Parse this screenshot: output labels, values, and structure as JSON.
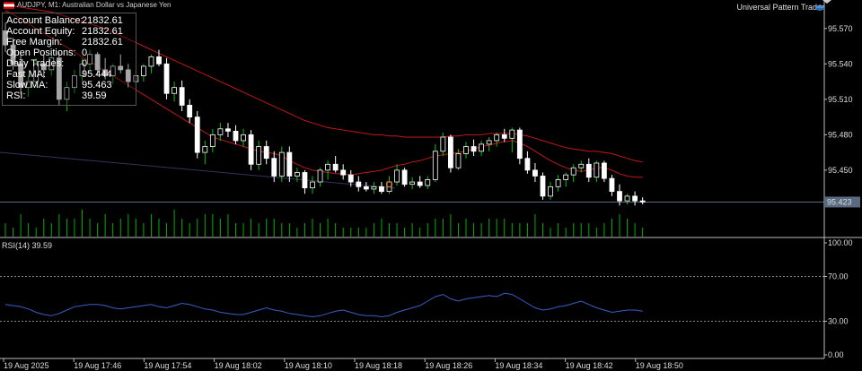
{
  "window": {
    "title": "AUDJPY, M1: Australian Dollar vs Japanese Yen",
    "expert_name": "Universal Pattern Trader"
  },
  "info_panel": {
    "rows": [
      {
        "label": "Account Balance:",
        "value": "21832.61"
      },
      {
        "label": "Account Equity:",
        "value": "21832.61"
      },
      {
        "label": "Free Margin:",
        "value": "21832.61"
      },
      {
        "label": "Open Positions:",
        "value": "0"
      },
      {
        "label": "Daily Trades:",
        "value": "0"
      },
      {
        "label": "Fast MA:",
        "value": "95.444"
      },
      {
        "label": "Slow MA:",
        "value": "95.463"
      },
      {
        "label": "RSI:",
        "value": "39.59"
      }
    ]
  },
  "price_axis": {
    "ticks": [
      "95.570",
      "95.540",
      "95.510",
      "95.480",
      "95.450"
    ],
    "current_price": "95.423"
  },
  "rsi_indicator": {
    "label": "RSI(14) 39.59",
    "ticks": [
      "100.00",
      "70.00",
      "30.00",
      "0.00"
    ]
  },
  "time_axis": {
    "ticks": [
      "19 Aug 2025",
      "19 Aug 17:46",
      "19 Aug 17:54",
      "19 Aug 18:02",
      "19 Aug 18:10",
      "19 Aug 18:18",
      "19 Aug 18:26",
      "19 Aug 18:34",
      "19 Aug 18:42",
      "19 Aug 18:50"
    ]
  },
  "colors": {
    "background": "#000000",
    "candle": "#ffffff",
    "bull_wick": "#00c800",
    "ma": "#c01818",
    "rsi": "#3a5ec8",
    "grid": "#888888",
    "volume": "#00b000",
    "current_price_bg": "#5a6a80"
  },
  "chart_data": {
    "type": "candlestick",
    "symbol": "AUDJPY",
    "timeframe": "M1",
    "ylim": [
      95.415,
      95.585
    ],
    "candles": [
      [
        95.568,
        95.575,
        95.55,
        95.556
      ],
      [
        95.556,
        95.562,
        95.535,
        95.54
      ],
      [
        95.54,
        95.548,
        95.515,
        95.52
      ],
      [
        95.52,
        95.53,
        95.512,
        95.525
      ],
      [
        95.525,
        95.545,
        95.52,
        95.54
      ],
      [
        95.54,
        95.548,
        95.528,
        95.535
      ],
      [
        95.535,
        95.55,
        95.53,
        95.545
      ],
      [
        95.545,
        95.55,
        95.505,
        95.51
      ],
      [
        95.51,
        95.525,
        95.5,
        95.52
      ],
      [
        95.52,
        95.535,
        95.515,
        95.53
      ],
      [
        95.53,
        95.545,
        95.525,
        95.54
      ],
      [
        95.54,
        95.552,
        95.534,
        95.548
      ],
      [
        95.548,
        95.55,
        95.53,
        95.535
      ],
      [
        95.535,
        95.545,
        95.527,
        95.53
      ],
      [
        95.53,
        95.54,
        95.523,
        95.538
      ],
      [
        95.538,
        95.548,
        95.532,
        95.535
      ],
      [
        95.535,
        95.54,
        95.52,
        95.525
      ],
      [
        95.525,
        95.535,
        95.518,
        95.53
      ],
      [
        95.53,
        95.54,
        95.525,
        95.538
      ],
      [
        95.538,
        95.548,
        95.532,
        95.546
      ],
      [
        95.546,
        95.552,
        95.538,
        95.54
      ],
      [
        95.54,
        95.545,
        95.51,
        95.515
      ],
      [
        95.515,
        95.525,
        95.508,
        95.52
      ],
      [
        95.52,
        95.526,
        95.5,
        95.505
      ],
      [
        95.505,
        95.51,
        95.49,
        95.495
      ],
      [
        95.495,
        95.5,
        95.46,
        95.465
      ],
      [
        95.465,
        95.475,
        95.455,
        95.47
      ],
      [
        95.47,
        95.485,
        95.465,
        95.48
      ],
      [
        95.48,
        95.49,
        95.475,
        95.485
      ],
      [
        95.485,
        95.49,
        95.478,
        95.483
      ],
      [
        95.483,
        95.488,
        95.472,
        95.475
      ],
      [
        95.475,
        95.485,
        95.47,
        95.48
      ],
      [
        95.48,
        95.484,
        95.45,
        95.455
      ],
      [
        95.455,
        95.475,
        95.45,
        95.47
      ],
      [
        95.47,
        95.475,
        95.455,
        95.46
      ],
      [
        95.46,
        95.466,
        95.44,
        95.445
      ],
      [
        95.445,
        95.47,
        95.44,
        95.465
      ],
      [
        95.465,
        95.47,
        95.44,
        95.445
      ],
      [
        95.445,
        95.452,
        95.44,
        95.448
      ],
      [
        95.448,
        95.45,
        95.43,
        95.435
      ],
      [
        95.435,
        95.445,
        95.43,
        95.44
      ],
      [
        95.44,
        95.452,
        95.436,
        95.45
      ],
      [
        95.45,
        95.458,
        95.442,
        95.455
      ],
      [
        95.455,
        95.462,
        95.448,
        95.45
      ],
      [
        95.45,
        95.455,
        95.442,
        95.446
      ],
      [
        95.446,
        95.45,
        95.436,
        95.44
      ],
      [
        95.44,
        95.445,
        95.432,
        95.436
      ],
      [
        95.436,
        95.44,
        95.432,
        95.434
      ],
      [
        95.434,
        95.44,
        95.43,
        95.436
      ],
      [
        95.436,
        95.44,
        95.43,
        95.432
      ],
      [
        95.432,
        95.445,
        95.43,
        95.44
      ],
      [
        95.44,
        95.455,
        95.437,
        95.45
      ],
      [
        95.45,
        95.452,
        95.436,
        95.438
      ],
      [
        95.438,
        95.444,
        95.434,
        95.44
      ],
      [
        95.44,
        95.445,
        95.435,
        95.437
      ],
      [
        95.437,
        95.445,
        95.434,
        95.442
      ],
      [
        95.442,
        95.472,
        95.44,
        95.466
      ],
      [
        95.466,
        95.482,
        95.462,
        95.478
      ],
      [
        95.478,
        95.48,
        95.448,
        95.452
      ],
      [
        95.452,
        95.468,
        95.45,
        95.464
      ],
      [
        95.464,
        95.474,
        95.46,
        95.47
      ],
      [
        95.47,
        95.476,
        95.462,
        95.466
      ],
      [
        95.466,
        95.475,
        95.462,
        95.472
      ],
      [
        95.472,
        95.478,
        95.466,
        95.475
      ],
      [
        95.475,
        95.482,
        95.47,
        95.48
      ],
      [
        95.48,
        95.485,
        95.474,
        95.477
      ],
      [
        95.477,
        95.486,
        95.465,
        95.484
      ],
      [
        95.484,
        95.486,
        95.455,
        95.46
      ],
      [
        95.46,
        95.466,
        95.447,
        95.45
      ],
      [
        95.45,
        95.456,
        95.44,
        95.445
      ],
      [
        95.445,
        95.448,
        95.425,
        95.428
      ],
      [
        95.428,
        95.44,
        95.425,
        95.436
      ],
      [
        95.436,
        95.446,
        95.432,
        95.442
      ],
      [
        95.442,
        95.448,
        95.436,
        95.446
      ],
      [
        95.446,
        95.455,
        95.44,
        95.452
      ],
      [
        95.452,
        95.458,
        95.448,
        95.455
      ],
      [
        95.455,
        95.46,
        95.44,
        95.444
      ],
      [
        95.444,
        95.458,
        95.44,
        95.456
      ],
      [
        95.456,
        95.458,
        95.44,
        95.443
      ],
      [
        95.443,
        95.446,
        95.428,
        95.432
      ],
      [
        95.432,
        95.438,
        95.42,
        95.424
      ],
      [
        95.424,
        95.43,
        95.421,
        95.428
      ],
      [
        95.428,
        95.432,
        95.42,
        95.424
      ],
      [
        95.424,
        95.427,
        95.421,
        95.423
      ]
    ],
    "fast_ma": [
      95.585,
      95.582,
      95.578,
      95.574,
      95.57,
      95.566,
      95.562,
      95.558,
      95.554,
      95.55,
      95.546,
      95.542,
      95.538,
      95.534,
      95.53,
      95.526,
      95.522,
      95.518,
      95.514,
      95.51,
      95.506,
      95.502,
      95.498,
      95.494,
      95.49,
      95.486,
      95.482,
      95.478,
      95.476,
      95.474,
      95.472,
      95.47,
      95.468,
      95.466,
      95.465,
      95.464,
      95.462,
      95.458,
      95.455,
      95.452,
      95.45,
      95.449,
      95.448,
      95.447,
      95.447,
      95.446,
      95.447,
      95.448,
      95.449,
      95.45,
      95.452,
      95.454,
      95.455,
      95.457,
      95.458,
      95.46,
      95.462,
      95.463,
      95.464,
      95.465,
      95.466,
      95.468,
      95.47,
      95.471,
      95.473,
      95.474,
      95.475,
      95.473,
      95.47,
      95.466,
      95.462,
      95.458,
      95.455,
      95.452,
      95.45,
      95.449,
      95.45,
      95.452,
      95.452,
      95.45,
      95.447,
      95.445,
      95.444,
      95.444
    ],
    "slow_ma": [
      95.59,
      95.589,
      95.588,
      95.587,
      95.586,
      95.585,
      95.584,
      95.582,
      95.58,
      95.578,
      95.576,
      95.574,
      95.572,
      95.57,
      95.567,
      95.564,
      95.561,
      95.558,
      95.555,
      95.552,
      95.549,
      95.546,
      95.543,
      95.54,
      95.537,
      95.534,
      95.531,
      95.528,
      95.525,
      95.522,
      95.519,
      95.516,
      95.513,
      95.51,
      95.507,
      95.504,
      95.501,
      95.498,
      95.495,
      95.492,
      95.49,
      95.488,
      95.486,
      95.485,
      95.484,
      95.483,
      95.482,
      95.481,
      95.48,
      95.48,
      95.479,
      95.479,
      95.478,
      95.478,
      95.478,
      95.478,
      95.478,
      95.478,
      95.479,
      95.479,
      95.48,
      95.48,
      95.48,
      95.481,
      95.481,
      95.481,
      95.481,
      95.48,
      95.479,
      95.477,
      95.475,
      95.473,
      95.471,
      95.469,
      95.468,
      95.467,
      95.466,
      95.466,
      95.465,
      95.464,
      95.462,
      95.46,
      95.458,
      95.457
    ],
    "rsi": [
      45,
      44,
      43,
      41,
      38,
      36,
      35,
      37,
      40,
      43,
      44,
      45,
      45,
      44,
      42,
      41,
      42,
      43,
      44,
      45,
      43,
      42,
      44,
      46,
      45,
      43,
      41,
      40,
      38,
      37,
      36,
      36,
      38,
      40,
      42,
      40,
      39,
      37,
      36,
      35,
      34,
      35,
      37,
      39,
      40,
      38,
      36,
      35,
      35,
      34,
      35,
      38,
      40,
      42,
      44,
      48,
      52,
      54,
      50,
      48,
      50,
      51,
      52,
      53,
      52,
      55,
      54,
      50,
      46,
      42,
      40,
      41,
      43,
      44,
      46,
      48,
      45,
      42,
      40,
      38,
      39,
      40,
      40,
      39
    ],
    "volume": [
      3,
      2,
      5,
      3,
      2,
      4,
      3,
      5,
      4,
      4,
      6,
      4,
      3,
      5,
      3,
      4,
      5,
      4,
      3,
      5,
      4,
      3,
      6,
      4,
      3,
      4,
      5,
      5,
      4,
      5,
      3,
      3,
      4,
      3,
      4,
      4,
      3,
      3,
      2,
      3,
      4,
      3,
      4,
      3,
      2,
      2,
      2,
      2,
      3,
      4,
      3,
      3,
      2,
      3,
      2,
      3,
      4,
      4,
      5,
      3,
      4,
      3,
      3,
      4,
      4,
      4,
      3,
      3,
      3,
      5,
      3,
      2,
      3,
      2,
      3,
      3,
      3,
      2,
      3,
      4,
      5,
      4,
      3,
      2
    ]
  }
}
